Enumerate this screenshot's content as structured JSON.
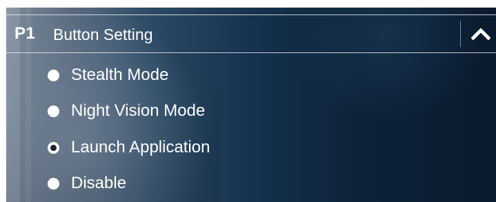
{
  "panel": {
    "player_badge": "P1",
    "title": "Button Setting",
    "collapse_icon": "chevron-up-icon"
  },
  "options": [
    {
      "label": "Stealth Mode",
      "selected": false
    },
    {
      "label": "Night Vision Mode",
      "selected": false
    },
    {
      "label": "Launch Application",
      "selected": true
    },
    {
      "label": "Disable",
      "selected": false
    }
  ]
}
